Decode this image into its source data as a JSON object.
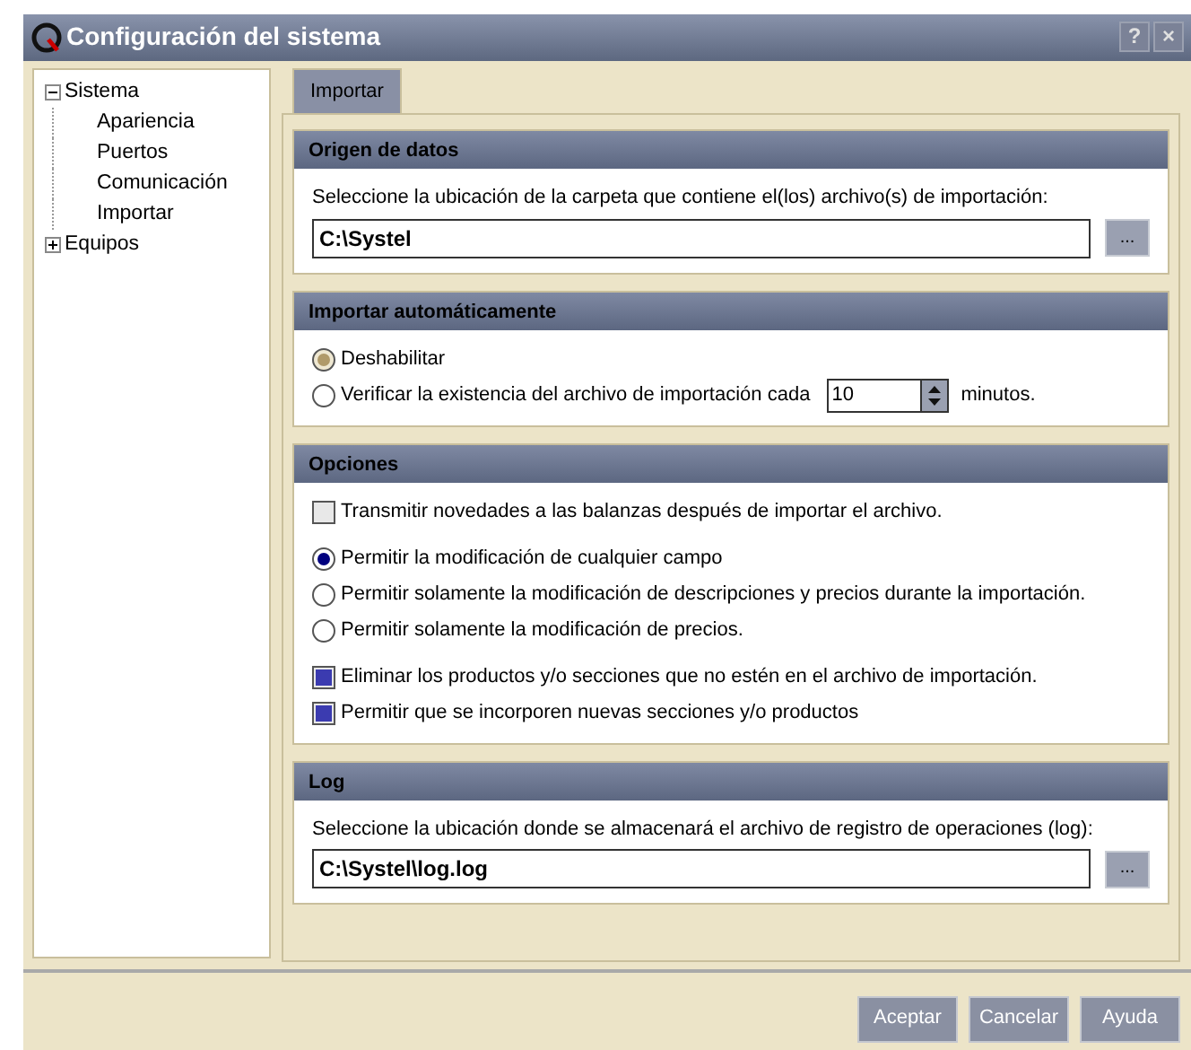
{
  "window": {
    "title": "Configuración del sistema",
    "help": "?",
    "close": "×"
  },
  "tree": [
    {
      "label": "Sistema",
      "expanded": true,
      "children": [
        {
          "label": "Apariencia"
        },
        {
          "label": "Puertos"
        },
        {
          "label": "Comunicación"
        },
        {
          "label": "Importar"
        }
      ]
    },
    {
      "label": "Equipos",
      "expanded": false
    }
  ],
  "tabs": [
    {
      "label": "Importar",
      "selected": true
    }
  ],
  "sections": [
    {
      "title": "Origen de datos",
      "prompt": "Seleccione la ubicación de la carpeta que contiene el(los) archivo(s) de importación:",
      "path": "C:\\Systel",
      "browse": "..."
    },
    {
      "title": "Importar automáticamente",
      "options": [
        {
          "kind": "radio",
          "label": "Deshabilitar",
          "selected": true
        },
        {
          "kind": "radio-spin",
          "label": "Verificar la existencia del archivo de importación cada",
          "selected": false,
          "value": "10",
          "suffix": "minutos."
        }
      ]
    },
    {
      "title": "Opciones",
      "options": [
        {
          "kind": "checkbox",
          "label": "Transmitir novedades a las balanzas después de importar el archivo.",
          "checked": false
        },
        {
          "kind": "radio",
          "label": "Permitir la modificación de cualquier campo",
          "selected": true
        },
        {
          "kind": "radio",
          "label": "Permitir solamente la modificación de descripciones y precios durante la importación.",
          "selected": false
        },
        {
          "kind": "radio",
          "label": "Permitir solamente la modificación de precios.",
          "selected": false
        },
        {
          "kind": "checkbox",
          "label": "Eliminar los productos y/o secciones que no estén en el archivo de importación.",
          "checked": true
        },
        {
          "kind": "checkbox",
          "label": "Permitir que se incorporen nuevas secciones y/o productos",
          "checked": true
        }
      ]
    },
    {
      "title": "Log",
      "prompt": "Seleccione la ubicación donde se almacenará el archivo de registro de operaciones (log):",
      "path": "C:\\Systel\\log.log",
      "browse": "..."
    }
  ],
  "buttons": [
    "Aceptar",
    "Cancelar",
    "Ayuda"
  ]
}
